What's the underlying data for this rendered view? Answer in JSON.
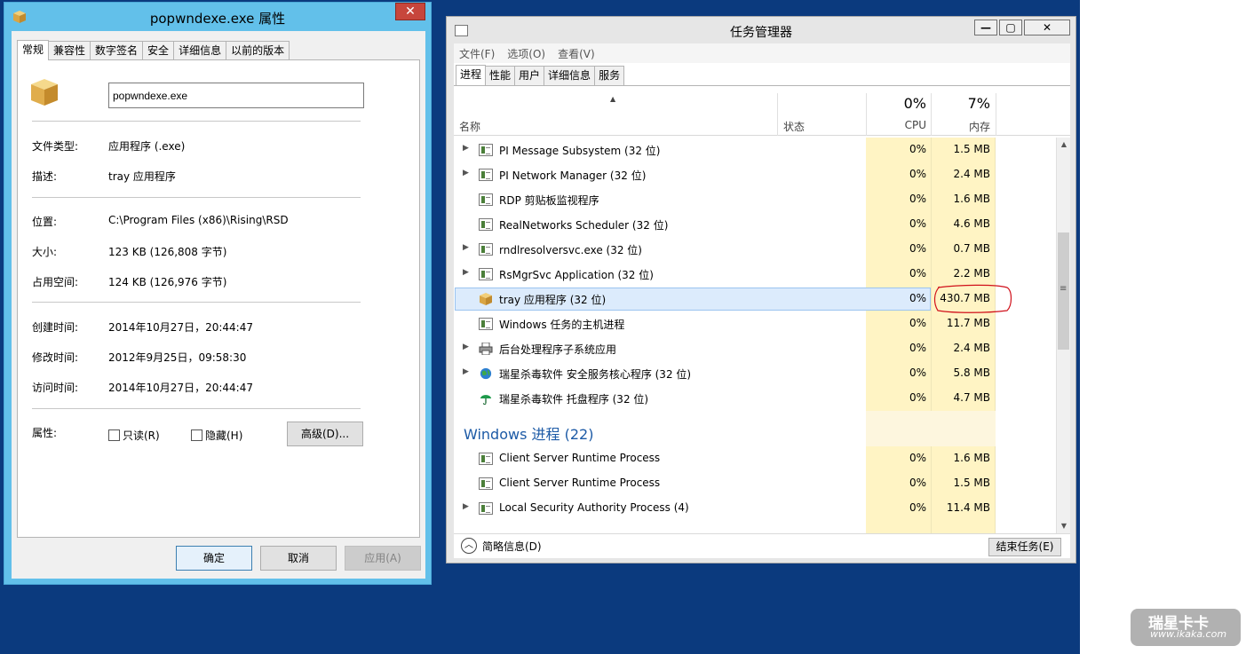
{
  "properties": {
    "title": "popwndexe.exe 属性",
    "close_label": "✕",
    "tabs": [
      "常规",
      "兼容性",
      "数字签名",
      "安全",
      "详细信息",
      "以前的版本"
    ],
    "file_name": "popwndexe.exe",
    "fields": [
      {
        "label": "文件类型:",
        "value": "应用程序 (.exe)"
      },
      {
        "label": "描述:",
        "value": "tray 应用程序"
      },
      {
        "label": "位置:",
        "value": "C:\\Program Files (x86)\\Rising\\RSD"
      },
      {
        "label": "大小:",
        "value": "123 KB (126,808 字节)"
      },
      {
        "label": "占用空间:",
        "value": "124 KB (126,976 字节)"
      },
      {
        "label": "创建时间:",
        "value": "2014年10月27日，20:44:47"
      },
      {
        "label": "修改时间:",
        "value": "2012年9月25日，09:58:30"
      },
      {
        "label": "访问时间:",
        "value": "2014年10月27日，20:44:47"
      }
    ],
    "attributes_label": "属性:",
    "readonly_label": "只读(R)",
    "hidden_label": "隐藏(H)",
    "advanced_label": "高级(D)...",
    "ok_label": "确定",
    "cancel_label": "取消",
    "apply_label": "应用(A)"
  },
  "taskmanager": {
    "title": "任务管理器",
    "window_buttons": [
      "—",
      "▢",
      "✕"
    ],
    "menu": [
      "文件(F)",
      "选项(O)",
      "查看(V)"
    ],
    "tabs": [
      "进程",
      "性能",
      "用户",
      "详细信息",
      "服务"
    ],
    "header": {
      "name": "名称",
      "status": "状态",
      "cpu_pct": "0%",
      "cpu_label": "CPU",
      "mem_pct": "7%",
      "mem_label": "内存"
    },
    "processes": [
      {
        "name": "PI Message Subsystem (32 位)",
        "cpu": "0%",
        "mem": "1.5 MB",
        "expandable": true,
        "icon": "app-icon"
      },
      {
        "name": "PI Network Manager (32 位)",
        "cpu": "0%",
        "mem": "2.4 MB",
        "expandable": true,
        "icon": "app-icon"
      },
      {
        "name": "RDP 剪贴板监视程序",
        "cpu": "0%",
        "mem": "1.6 MB",
        "expandable": false,
        "icon": "app-icon"
      },
      {
        "name": "RealNetworks Scheduler (32 位)",
        "cpu": "0%",
        "mem": "4.6 MB",
        "expandable": false,
        "icon": "app-icon"
      },
      {
        "name": "rndlresolversvc.exe (32 位)",
        "cpu": "0%",
        "mem": "0.7 MB",
        "expandable": true,
        "icon": "app-icon"
      },
      {
        "name": "RsMgrSvc Application (32 位)",
        "cpu": "0%",
        "mem": "2.2 MB",
        "expandable": true,
        "icon": "app-icon"
      },
      {
        "name": "tray 应用程序 (32 位)",
        "cpu": "0%",
        "mem": "430.7 MB",
        "expandable": false,
        "icon": "package-icon",
        "selected": true
      },
      {
        "name": "Windows 任务的主机进程",
        "cpu": "0%",
        "mem": "11.7 MB",
        "expandable": false,
        "icon": "app-icon"
      },
      {
        "name": "后台处理程序子系统应用",
        "cpu": "0%",
        "mem": "2.4 MB",
        "expandable": true,
        "icon": "printer-icon"
      },
      {
        "name": "瑞星杀毒软件 安全服务核心程序 (32 位)",
        "cpu": "0%",
        "mem": "5.8 MB",
        "expandable": true,
        "icon": "globe-icon"
      },
      {
        "name": "瑞星杀毒软件 托盘程序 (32 位)",
        "cpu": "0%",
        "mem": "4.7 MB",
        "expandable": false,
        "icon": "umbrella-icon"
      }
    ],
    "windows_section": "Windows 进程 (22)",
    "windows_processes": [
      {
        "name": "Client Server Runtime Process",
        "cpu": "0%",
        "mem": "1.6 MB",
        "expandable": false,
        "icon": "app-icon"
      },
      {
        "name": "Client Server Runtime Process",
        "cpu": "0%",
        "mem": "1.5 MB",
        "expandable": false,
        "icon": "app-icon"
      },
      {
        "name": "Local Security Authority Process (4)",
        "cpu": "0%",
        "mem": "11.4 MB",
        "expandable": true,
        "icon": "app-icon"
      }
    ],
    "fewer_details": "简略信息(D)",
    "end_task": "结束任务(E)"
  },
  "watermark": {
    "line1": "瑞星卡卡",
    "line2": "www.ikaka.com"
  },
  "colors": {
    "desktop": "#0b3a7e",
    "dialog_frame": "#62c0ea",
    "highlight": "#fff4c4",
    "section": "#1c5aa6",
    "annotation": "#d0101a"
  }
}
